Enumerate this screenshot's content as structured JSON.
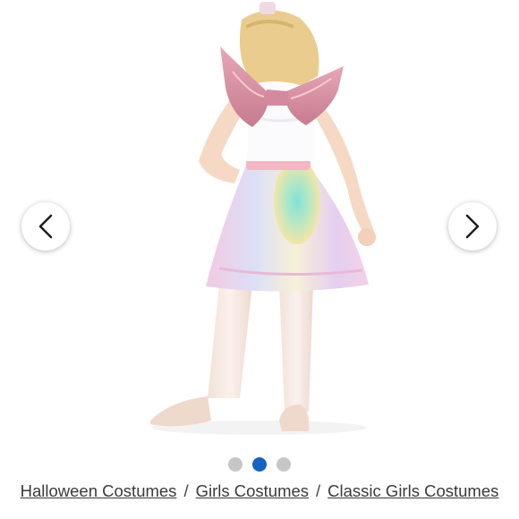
{
  "gallery": {
    "image_alt": "Unicorn costume with pink wings and rainbow tulle skirt, back view",
    "prev_icon": "chevron-left-icon",
    "next_icon": "chevron-right-icon",
    "dot_count": 3,
    "active_dot": 1,
    "colors": {
      "active_dot": "#1565c0",
      "inactive_dot": "#c6c6c6"
    }
  },
  "breadcrumb": {
    "items": [
      "Halloween Costumes",
      "Girls Costumes",
      "Classic Girls Costumes"
    ],
    "separator": "/"
  }
}
